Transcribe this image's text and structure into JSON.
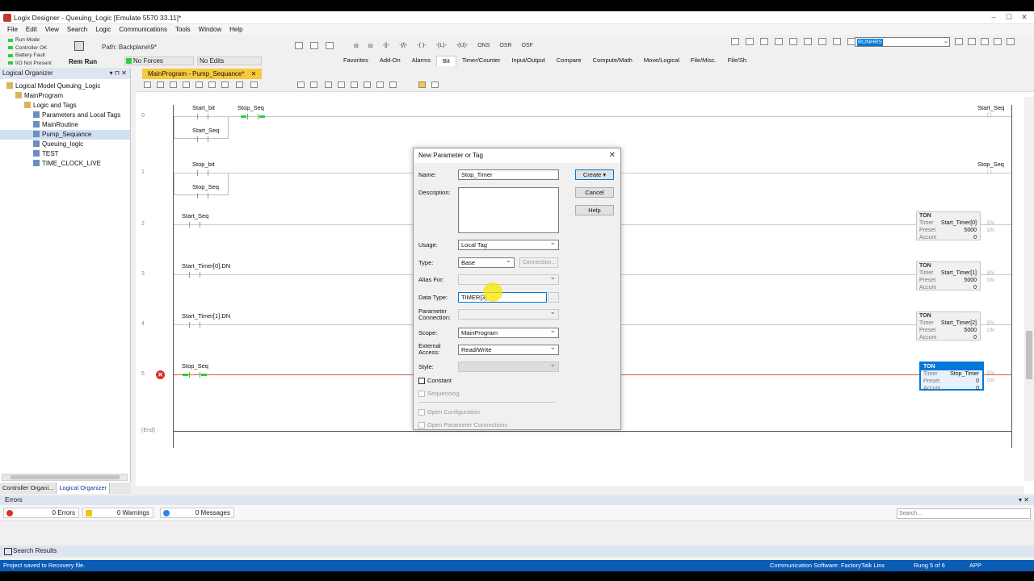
{
  "window": {
    "title": "Logix Designer - Queuing_Logic [Emulate 5570 33.11]*",
    "controls": [
      "–",
      "☐",
      "✕"
    ]
  },
  "menu": [
    "File",
    "Edit",
    "View",
    "Search",
    "Logic",
    "Communications",
    "Tools",
    "Window",
    "Help"
  ],
  "controller_status": [
    {
      "label": "Run Mode",
      "color": "#2ecc40"
    },
    {
      "label": "Controller OK",
      "color": "#2ecc40"
    },
    {
      "label": "Battery Fault",
      "color": "#2ecc40"
    },
    {
      "label": "I/O Not Present",
      "color": "#2ecc40"
    }
  ],
  "mode": {
    "state": "Rem Run",
    "path": "Path: Backplane\\9*",
    "forces": "No Forces",
    "edits": "No Edits"
  },
  "instructions": [
    "ONS",
    "OSR",
    "OSF"
  ],
  "instruction_tabs": [
    "Favorites",
    "Add-On",
    "Alarms",
    "Bit",
    "Timer/Counter",
    "Input/Output",
    "Compare",
    "Compute/Math",
    "Move/Logical",
    "File/Misc.",
    "File/Sh"
  ],
  "active_instruction_tab": "Bit",
  "toolbar_search": "RUNHRS",
  "organizer": {
    "title": "Logical Organizer",
    "tree": [
      {
        "label": "Logical Model Queuing_Logic",
        "indent": 0
      },
      {
        "label": "MainProgram",
        "indent": 1
      },
      {
        "label": "Logic and Tags",
        "indent": 2
      },
      {
        "label": "Parameters and Local Tags",
        "indent": 3
      },
      {
        "label": "MainRoutine",
        "indent": 3
      },
      {
        "label": "Pump_Sequance",
        "indent": 3,
        "selected": true
      },
      {
        "label": "Queuing_logic",
        "indent": 3
      },
      {
        "label": "TEST",
        "indent": 3
      },
      {
        "label": "TIME_CLOCK_LIVE",
        "indent": 3
      }
    ],
    "tabs": [
      "Controller Organi...",
      "Logical Organizer"
    ]
  },
  "editor": {
    "tab": "MainProgram - Pump_Sequance*",
    "rungs": [
      {
        "num": "0",
        "contact": "Start_bit",
        "coil": "Stop_Seq",
        "branch": "Start_Seq",
        "output": "Start_Seq"
      },
      {
        "num": "1",
        "contact": "Stop_bit",
        "branch": "Stop_Seq",
        "output": "Stop_Seq"
      },
      {
        "num": "2",
        "contact": "Start_Seq",
        "timer": {
          "name": "Start_Timer[0]",
          "preset": "5000",
          "accum": "0"
        }
      },
      {
        "num": "3",
        "contact": "Start_Timer[0].DN",
        "timer": {
          "name": "Start_Timer[1]",
          "preset": "5000",
          "accum": "0"
        }
      },
      {
        "num": "4",
        "contact": "Start_Timer[1].DN",
        "timer": {
          "name": "Start_Timer[2]",
          "preset": "5000",
          "accum": "0"
        }
      },
      {
        "num": "5",
        "contact": "Stop_Seq",
        "timer": {
          "name": "Stop_Timer",
          "preset": "0",
          "accum": "0"
        }
      }
    ],
    "end_label": "(End)",
    "ton_labels": {
      "head": "TON",
      "timer": "Timer",
      "preset": "Preset",
      "accum": "Accum",
      "en": "EN",
      "dn": "DN"
    }
  },
  "dialog": {
    "title": "New Parameter or Tag",
    "name_label": "Name:",
    "name_value": "Stop_Timer",
    "description_label": "Description:",
    "usage_label": "Usage:",
    "usage_value": "Local Tag",
    "type_label": "Type:",
    "type_value": "Base",
    "connection_button": "Connection...",
    "alias_label": "Alias For:",
    "datatype_label": "Data Type:",
    "datatype_value": "TIMER[3]",
    "param_conn_label": "Parameter Connection:",
    "scope_label": "Scope:",
    "scope_value": "MainProgram",
    "external_label": "External Access:",
    "external_value": "Read/Write",
    "style_label": "Style:",
    "constant_label": "Constant",
    "sequencing_label": "Sequencing",
    "open_config_label": "Open Configuration",
    "open_param_label": "Open Parameter Connections",
    "create": "Create",
    "cancel": "Cancel",
    "help": "Help"
  },
  "errors_panel": {
    "title": "Errors",
    "errors": "0 Errors",
    "warnings": "0 Warnings",
    "messages": "0 Messages",
    "search_placeholder": "Search..."
  },
  "search_results": "Search Results",
  "statusbar": {
    "left": "Project saved to Recovery file.",
    "comm": "Communication Software: FactoryTalk Linx",
    "rung": "Rung 5 of 6",
    "app": "APP"
  }
}
